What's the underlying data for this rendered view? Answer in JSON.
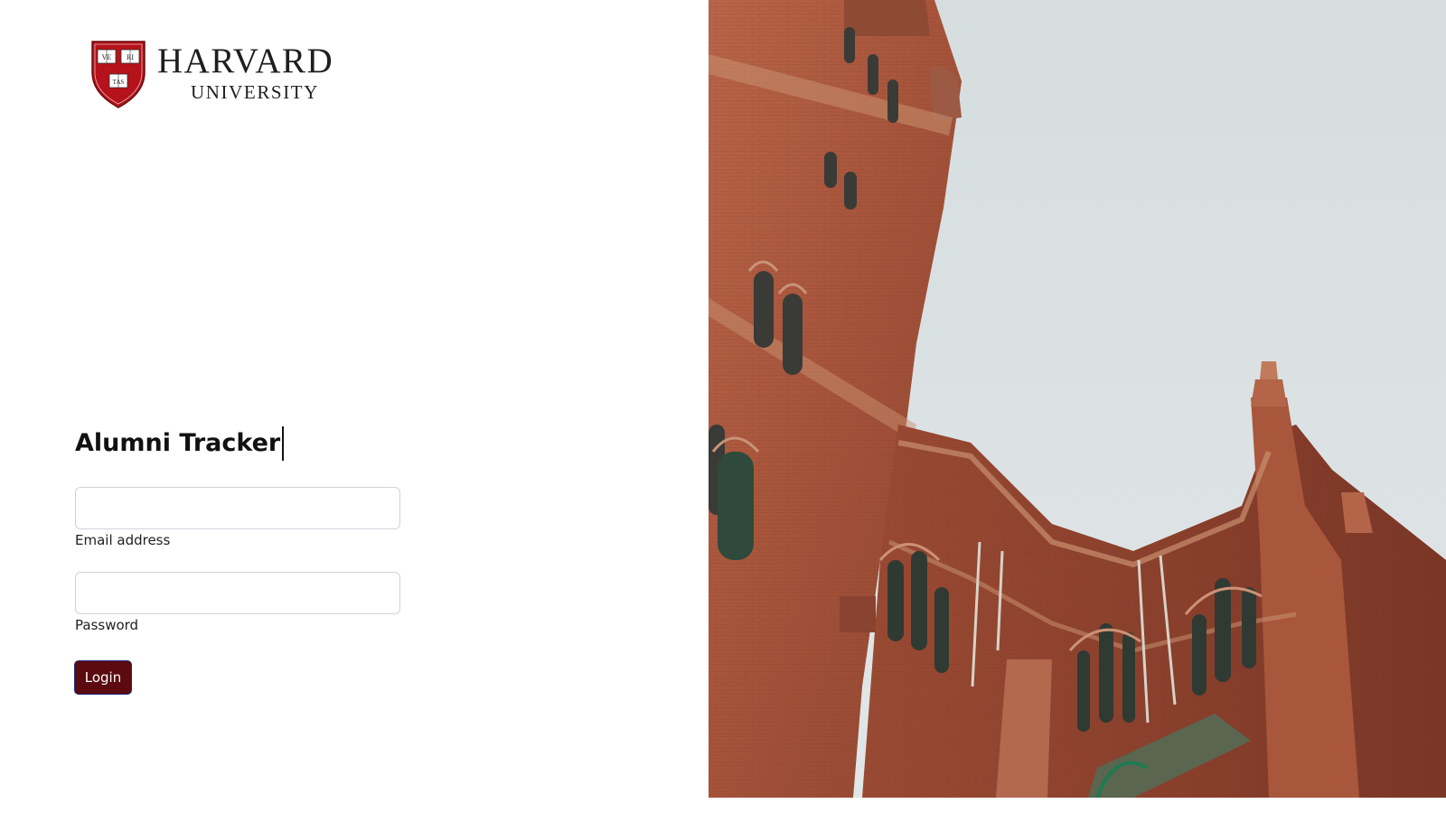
{
  "logo": {
    "wordmark_line1": "HARVARD",
    "wordmark_line2": "UNIVERSITY",
    "shield_books": [
      "VE",
      "RI",
      "TAS"
    ],
    "shield_color": "#b5121b"
  },
  "login": {
    "title": "Alumni Tracker",
    "email_label": "Email address",
    "email_value": "",
    "password_label": "Password",
    "password_value": "",
    "button_label": "Login"
  },
  "colors": {
    "button_bg": "#5b0a0f",
    "button_border": "#1b2a78",
    "brick": "#a8543a",
    "sky": "#d9e0e1"
  },
  "hero": {
    "icon": "brick-tower-building-photo"
  }
}
